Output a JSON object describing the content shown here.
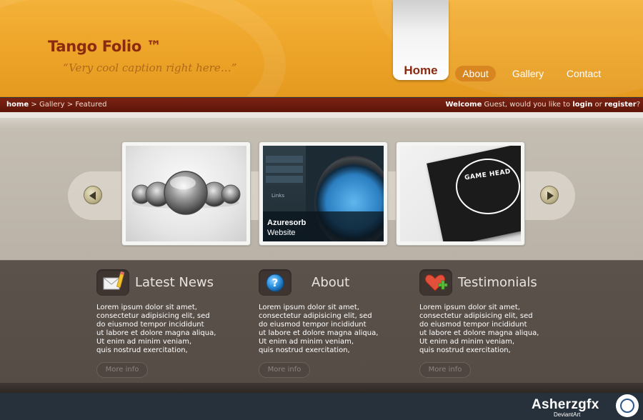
{
  "header": {
    "logo_title": "Tango Folio ™",
    "caption": "“Very cool caption right here…”",
    "nav": {
      "home": "Home",
      "about": "About",
      "gallery": "Gallery",
      "contact": "Contact"
    }
  },
  "breadcrumb": {
    "home": "home",
    "separator": " > ",
    "gallery": "Gallery",
    "featured": "Featured",
    "welcome": "Welcome",
    "guest_text": " Guest, would you like to ",
    "login": "login",
    "or": " or ",
    "register": "register",
    "question": "?"
  },
  "showcase": {
    "items": [
      {
        "title": "",
        "subtitle": ""
      },
      {
        "title": "Azuresorb",
        "subtitle": "Website",
        "links_label": "Links"
      },
      {
        "title": "",
        "subtitle": "",
        "card_text": "GAME HEAD"
      }
    ]
  },
  "columns": [
    {
      "title": "Latest News",
      "icon": "mail-pencil-icon",
      "body": "Lorem ipsum dolor sit amet,\nconsectetur adipisicing elit, sed\ndo eiusmod tempor incididunt\nut labore et dolore magna aliqua,\nUt enim ad minim veniam,\nquis nostrud exercitation,",
      "button": "More info"
    },
    {
      "title": "About",
      "icon": "question-icon",
      "body": "Lorem ipsum dolor sit amet,\nconsectetur adipisicing elit, sed\ndo eiusmod tempor incididunt\nut labore et dolore magna aliqua,\nUt enim ad minim veniam,\nquis nostrud exercitation,",
      "button": "More info"
    },
    {
      "title": "Testimonials",
      "icon": "heart-plus-icon",
      "body": "Lorem ipsum dolor sit amet,\nconsectetur adipisicing elit, sed\ndo eiusmod tempor incididunt\nut labore et dolore magna aliqua,\nUt enim ad minim veniam,\nquis nostrud exercitation,",
      "button": "More info"
    }
  ],
  "watermark": {
    "name": "Asherzgfx",
    "sub": "DeviantArt"
  },
  "colors": {
    "header_orange": "#eea62a",
    "brand_red": "#8b2a10",
    "crumb_bar": "#6a1b0d",
    "content_bg": "#5a504a",
    "footer_bg": "#26313c"
  }
}
